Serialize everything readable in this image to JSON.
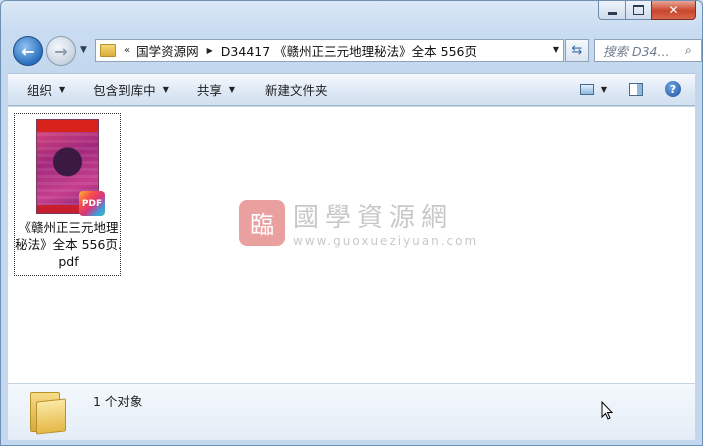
{
  "window": {
    "title_buttons": {
      "minimize": "minimize",
      "maximize": "maximize",
      "close": "✕"
    }
  },
  "nav": {
    "back_icon": "arrow-left-icon",
    "forward_icon": "arrow-right-icon",
    "breadcrumb_prefix": "«",
    "breadcrumbs": [
      "国学资源网",
      "D34417 《赣州正三元地理秘法》全本 556页"
    ],
    "refresh_icon": "refresh-icon",
    "search_placeholder": "搜索 D34..."
  },
  "toolbar": {
    "organize": "组织",
    "include_in_library": "包含到库中",
    "share": "共享",
    "new_folder": "新建文件夹"
  },
  "files": [
    {
      "name": "《赣州正三元地理秘法》全本 556页.pdf",
      "badge": "PDF"
    }
  ],
  "watermark": {
    "seal": "臨",
    "name": "國學資源網",
    "url": "www.guoxueziyuan.com"
  },
  "status": {
    "count_text": "1 个对象"
  },
  "colors": {
    "accent": "#2a6fbd",
    "close": "#c9452c",
    "watermark_red": "#d9534f"
  }
}
